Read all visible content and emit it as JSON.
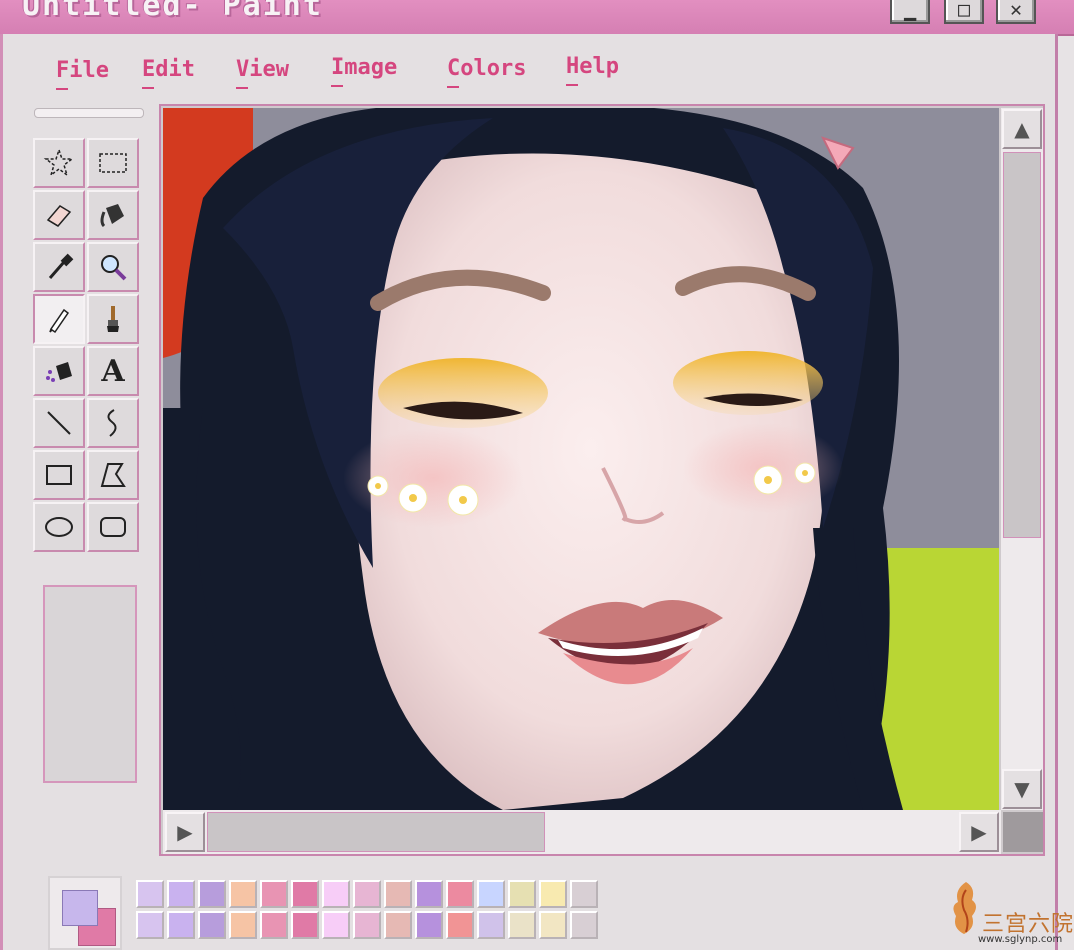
{
  "window": {
    "title": "Untitled- Paint",
    "buttons": [
      {
        "name": "minimize-button",
        "glyph": "▁"
      },
      {
        "name": "maximize-button",
        "glyph": "□"
      },
      {
        "name": "close-button",
        "glyph": "✕"
      }
    ]
  },
  "menu": [
    {
      "label": "File"
    },
    {
      "label": "Edit"
    },
    {
      "label": "View"
    },
    {
      "label": "Image"
    },
    {
      "label": "Colors"
    },
    {
      "label": "Help"
    }
  ],
  "tools": [
    {
      "name": "free-select-icon",
      "active": false
    },
    {
      "name": "rect-select-icon",
      "active": false
    },
    {
      "name": "eraser-icon",
      "active": false
    },
    {
      "name": "fill-bucket-icon",
      "active": false
    },
    {
      "name": "color-picker-icon",
      "active": false
    },
    {
      "name": "magnifier-icon",
      "active": false
    },
    {
      "name": "pencil-icon",
      "active": true
    },
    {
      "name": "brush-icon",
      "active": false
    },
    {
      "name": "airbrush-icon",
      "active": false
    },
    {
      "name": "text-icon",
      "active": false,
      "glyph": "A"
    },
    {
      "name": "line-icon",
      "active": false
    },
    {
      "name": "curve-icon",
      "active": false
    },
    {
      "name": "rectangle-icon",
      "active": false
    },
    {
      "name": "polygon-icon",
      "active": false
    },
    {
      "name": "ellipse-icon",
      "active": false
    },
    {
      "name": "rounded-rect-icon",
      "active": false
    }
  ],
  "scroll": {
    "up": "▲",
    "down": "▼",
    "left": "▶",
    "right": "▶"
  },
  "colors": {
    "accent": "#d5467f",
    "title_bar": "#d985b8",
    "foreground": "#c7b7ec",
    "background": "#e07aa6"
  },
  "palette": [
    [
      "#d7c4ef",
      "#c9b2ef",
      "#b79ddc",
      "#f6c4a5",
      "#e894b3",
      "#e07aa6",
      "#f7cdf7",
      "#e7b5d3",
      "#e6b9b4",
      "#b691dd",
      "#ec8aa0",
      "#c8d5ff",
      "#e6e0b2",
      "#f8eab0",
      "#d8cfd4"
    ],
    [
      "#d7c4ef",
      "#c9b2ef",
      "#b79ddc",
      "#f6c4a5",
      "#e894b3",
      "#e07aa6",
      "#f7cdf7",
      "#e7b5d3",
      "#e6b9b4",
      "#b691dd",
      "#f19495",
      "#d0c2ea",
      "#eae2c8",
      "#f2e6c3",
      "#d8cfd4"
    ]
  ],
  "watermark": {
    "text": "三宫六院",
    "url": "www.sglynp.com"
  }
}
